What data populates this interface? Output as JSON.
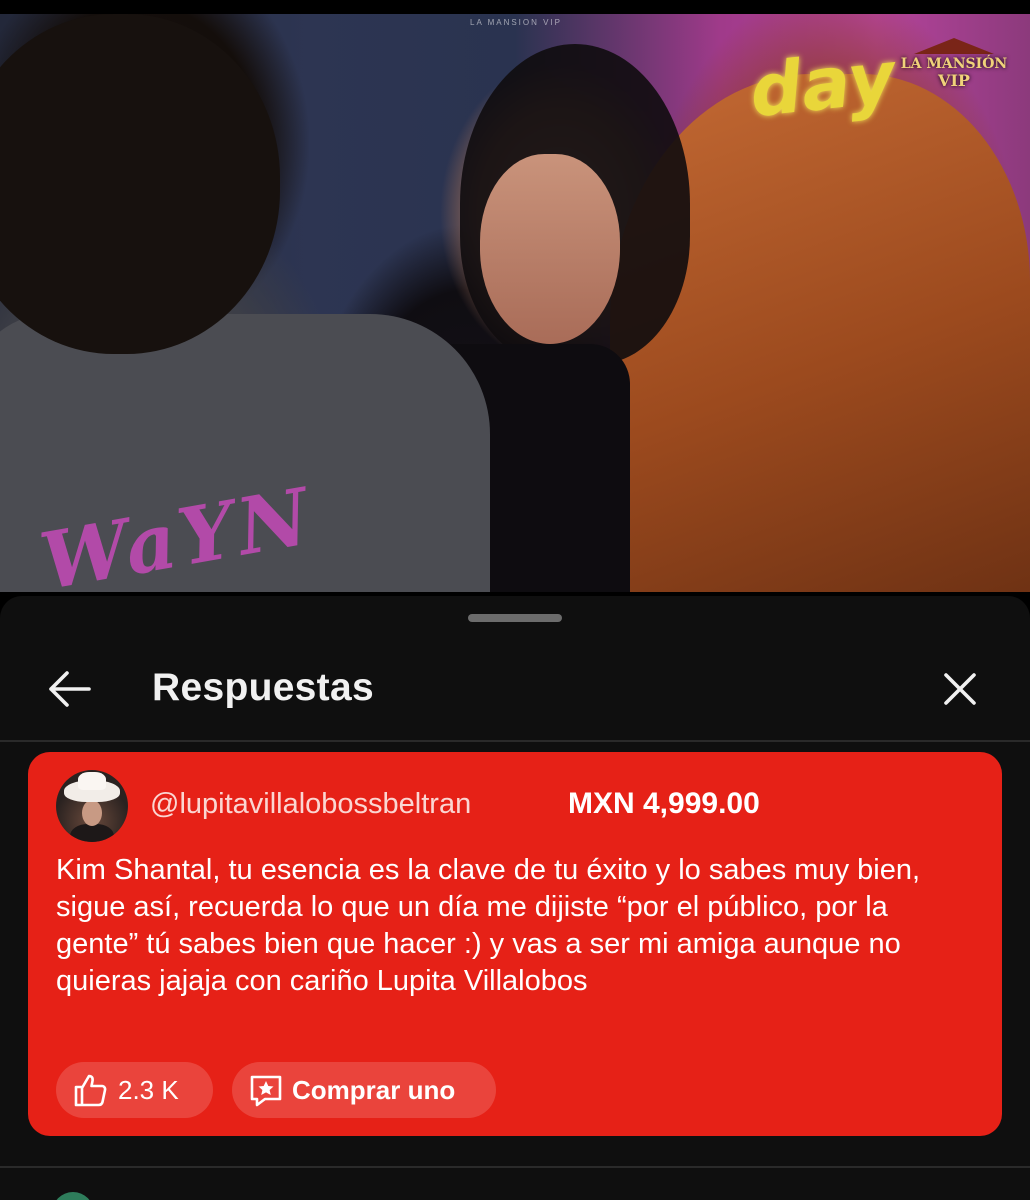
{
  "video": {
    "channel_watermark": "LA MANSION VIP",
    "logo_line1": "LA MANSIÓN",
    "logo_line2": "VIP",
    "neon_sign": "day",
    "shirt_print": "WaYN"
  },
  "sheet": {
    "title": "Respuestas"
  },
  "super_chat": {
    "username": "@lupitavillalobossbeltran",
    "amount": "MXN 4,999.00",
    "message": "Kim Shantal, tu esencia es la clave de tu éxito y lo sabes muy bien, sigue así, recuerda lo que un día me dijiste “por el público, por la gente” tú sabes bien que hacer :) y vas a ser mi amiga aunque no quieras jajaja con cariño Lupita Villalobos",
    "likes": "2.3 K",
    "buy_label": "Comprar uno",
    "card_color": "#e62117"
  },
  "icons": {
    "back": "arrow-left-icon",
    "close": "close-icon",
    "like": "thumbs-up-icon",
    "buy": "super-sticker-icon"
  }
}
